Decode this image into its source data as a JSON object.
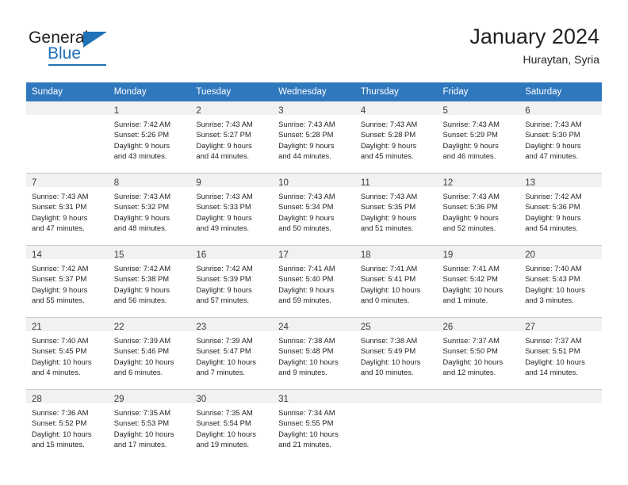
{
  "logo": {
    "word_one": "General",
    "word_two": "Blue",
    "triangle_icon": "blue-triangle-icon"
  },
  "header": {
    "title": "January 2024",
    "subtitle": "Huraytan, Syria"
  },
  "calendar": {
    "weekday_headers": [
      "Sunday",
      "Monday",
      "Tuesday",
      "Wednesday",
      "Thursday",
      "Friday",
      "Saturday"
    ],
    "accent_color": "#3078bd",
    "band_color": "#f1f1f1",
    "weeks": [
      [
        {
          "day": "",
          "lines": []
        },
        {
          "day": "1",
          "lines": [
            "Sunrise: 7:42 AM",
            "Sunset: 5:26 PM",
            "Daylight: 9 hours",
            "and 43 minutes."
          ]
        },
        {
          "day": "2",
          "lines": [
            "Sunrise: 7:43 AM",
            "Sunset: 5:27 PM",
            "Daylight: 9 hours",
            "and 44 minutes."
          ]
        },
        {
          "day": "3",
          "lines": [
            "Sunrise: 7:43 AM",
            "Sunset: 5:28 PM",
            "Daylight: 9 hours",
            "and 44 minutes."
          ]
        },
        {
          "day": "4",
          "lines": [
            "Sunrise: 7:43 AM",
            "Sunset: 5:28 PM",
            "Daylight: 9 hours",
            "and 45 minutes."
          ]
        },
        {
          "day": "5",
          "lines": [
            "Sunrise: 7:43 AM",
            "Sunset: 5:29 PM",
            "Daylight: 9 hours",
            "and 46 minutes."
          ]
        },
        {
          "day": "6",
          "lines": [
            "Sunrise: 7:43 AM",
            "Sunset: 5:30 PM",
            "Daylight: 9 hours",
            "and 47 minutes."
          ]
        }
      ],
      [
        {
          "day": "7",
          "lines": [
            "Sunrise: 7:43 AM",
            "Sunset: 5:31 PM",
            "Daylight: 9 hours",
            "and 47 minutes."
          ]
        },
        {
          "day": "8",
          "lines": [
            "Sunrise: 7:43 AM",
            "Sunset: 5:32 PM",
            "Daylight: 9 hours",
            "and 48 minutes."
          ]
        },
        {
          "day": "9",
          "lines": [
            "Sunrise: 7:43 AM",
            "Sunset: 5:33 PM",
            "Daylight: 9 hours",
            "and 49 minutes."
          ]
        },
        {
          "day": "10",
          "lines": [
            "Sunrise: 7:43 AM",
            "Sunset: 5:34 PM",
            "Daylight: 9 hours",
            "and 50 minutes."
          ]
        },
        {
          "day": "11",
          "lines": [
            "Sunrise: 7:43 AM",
            "Sunset: 5:35 PM",
            "Daylight: 9 hours",
            "and 51 minutes."
          ]
        },
        {
          "day": "12",
          "lines": [
            "Sunrise: 7:43 AM",
            "Sunset: 5:36 PM",
            "Daylight: 9 hours",
            "and 52 minutes."
          ]
        },
        {
          "day": "13",
          "lines": [
            "Sunrise: 7:42 AM",
            "Sunset: 5:36 PM",
            "Daylight: 9 hours",
            "and 54 minutes."
          ]
        }
      ],
      [
        {
          "day": "14",
          "lines": [
            "Sunrise: 7:42 AM",
            "Sunset: 5:37 PM",
            "Daylight: 9 hours",
            "and 55 minutes."
          ]
        },
        {
          "day": "15",
          "lines": [
            "Sunrise: 7:42 AM",
            "Sunset: 5:38 PM",
            "Daylight: 9 hours",
            "and 56 minutes."
          ]
        },
        {
          "day": "16",
          "lines": [
            "Sunrise: 7:42 AM",
            "Sunset: 5:39 PM",
            "Daylight: 9 hours",
            "and 57 minutes."
          ]
        },
        {
          "day": "17",
          "lines": [
            "Sunrise: 7:41 AM",
            "Sunset: 5:40 PM",
            "Daylight: 9 hours",
            "and 59 minutes."
          ]
        },
        {
          "day": "18",
          "lines": [
            "Sunrise: 7:41 AM",
            "Sunset: 5:41 PM",
            "Daylight: 10 hours",
            "and 0 minutes."
          ]
        },
        {
          "day": "19",
          "lines": [
            "Sunrise: 7:41 AM",
            "Sunset: 5:42 PM",
            "Daylight: 10 hours",
            "and 1 minute."
          ]
        },
        {
          "day": "20",
          "lines": [
            "Sunrise: 7:40 AM",
            "Sunset: 5:43 PM",
            "Daylight: 10 hours",
            "and 3 minutes."
          ]
        }
      ],
      [
        {
          "day": "21",
          "lines": [
            "Sunrise: 7:40 AM",
            "Sunset: 5:45 PM",
            "Daylight: 10 hours",
            "and 4 minutes."
          ]
        },
        {
          "day": "22",
          "lines": [
            "Sunrise: 7:39 AM",
            "Sunset: 5:46 PM",
            "Daylight: 10 hours",
            "and 6 minutes."
          ]
        },
        {
          "day": "23",
          "lines": [
            "Sunrise: 7:39 AM",
            "Sunset: 5:47 PM",
            "Daylight: 10 hours",
            "and 7 minutes."
          ]
        },
        {
          "day": "24",
          "lines": [
            "Sunrise: 7:38 AM",
            "Sunset: 5:48 PM",
            "Daylight: 10 hours",
            "and 9 minutes."
          ]
        },
        {
          "day": "25",
          "lines": [
            "Sunrise: 7:38 AM",
            "Sunset: 5:49 PM",
            "Daylight: 10 hours",
            "and 10 minutes."
          ]
        },
        {
          "day": "26",
          "lines": [
            "Sunrise: 7:37 AM",
            "Sunset: 5:50 PM",
            "Daylight: 10 hours",
            "and 12 minutes."
          ]
        },
        {
          "day": "27",
          "lines": [
            "Sunrise: 7:37 AM",
            "Sunset: 5:51 PM",
            "Daylight: 10 hours",
            "and 14 minutes."
          ]
        }
      ],
      [
        {
          "day": "28",
          "lines": [
            "Sunrise: 7:36 AM",
            "Sunset: 5:52 PM",
            "Daylight: 10 hours",
            "and 15 minutes."
          ]
        },
        {
          "day": "29",
          "lines": [
            "Sunrise: 7:35 AM",
            "Sunset: 5:53 PM",
            "Daylight: 10 hours",
            "and 17 minutes."
          ]
        },
        {
          "day": "30",
          "lines": [
            "Sunrise: 7:35 AM",
            "Sunset: 5:54 PM",
            "Daylight: 10 hours",
            "and 19 minutes."
          ]
        },
        {
          "day": "31",
          "lines": [
            "Sunrise: 7:34 AM",
            "Sunset: 5:55 PM",
            "Daylight: 10 hours",
            "and 21 minutes."
          ]
        },
        {
          "day": "",
          "lines": []
        },
        {
          "day": "",
          "lines": []
        },
        {
          "day": "",
          "lines": []
        }
      ]
    ]
  }
}
